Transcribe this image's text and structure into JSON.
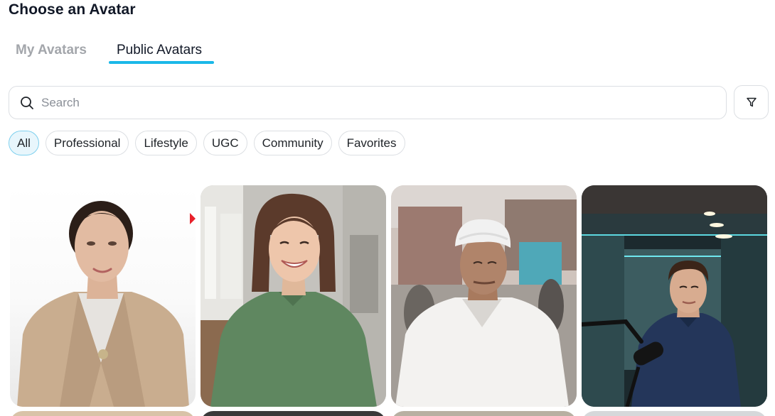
{
  "page": {
    "title": "Choose an Avatar"
  },
  "tabs": [
    {
      "label": "My Avatars",
      "active": false
    },
    {
      "label": "Public Avatars",
      "active": true
    }
  ],
  "search": {
    "placeholder": "Search",
    "value": ""
  },
  "filter": {
    "icon": "filter-icon"
  },
  "chips": [
    {
      "label": "All",
      "selected": true
    },
    {
      "label": "Professional",
      "selected": false
    },
    {
      "label": "Lifestyle",
      "selected": false
    },
    {
      "label": "UGC",
      "selected": false
    },
    {
      "label": "Community",
      "selected": false
    },
    {
      "label": "Favorites",
      "selected": false
    }
  ],
  "avatars": [
    {
      "description": "woman in beige blazer on white background"
    },
    {
      "description": "smiling woman in green top in kitchen"
    },
    {
      "description": "man in white turban and shirt outdoors"
    },
    {
      "description": "man in blue shirt in podcast studio with microphone"
    }
  ],
  "colors": {
    "accent": "#1ab8e8",
    "chip_selected_bg": "#e8f6fc"
  }
}
